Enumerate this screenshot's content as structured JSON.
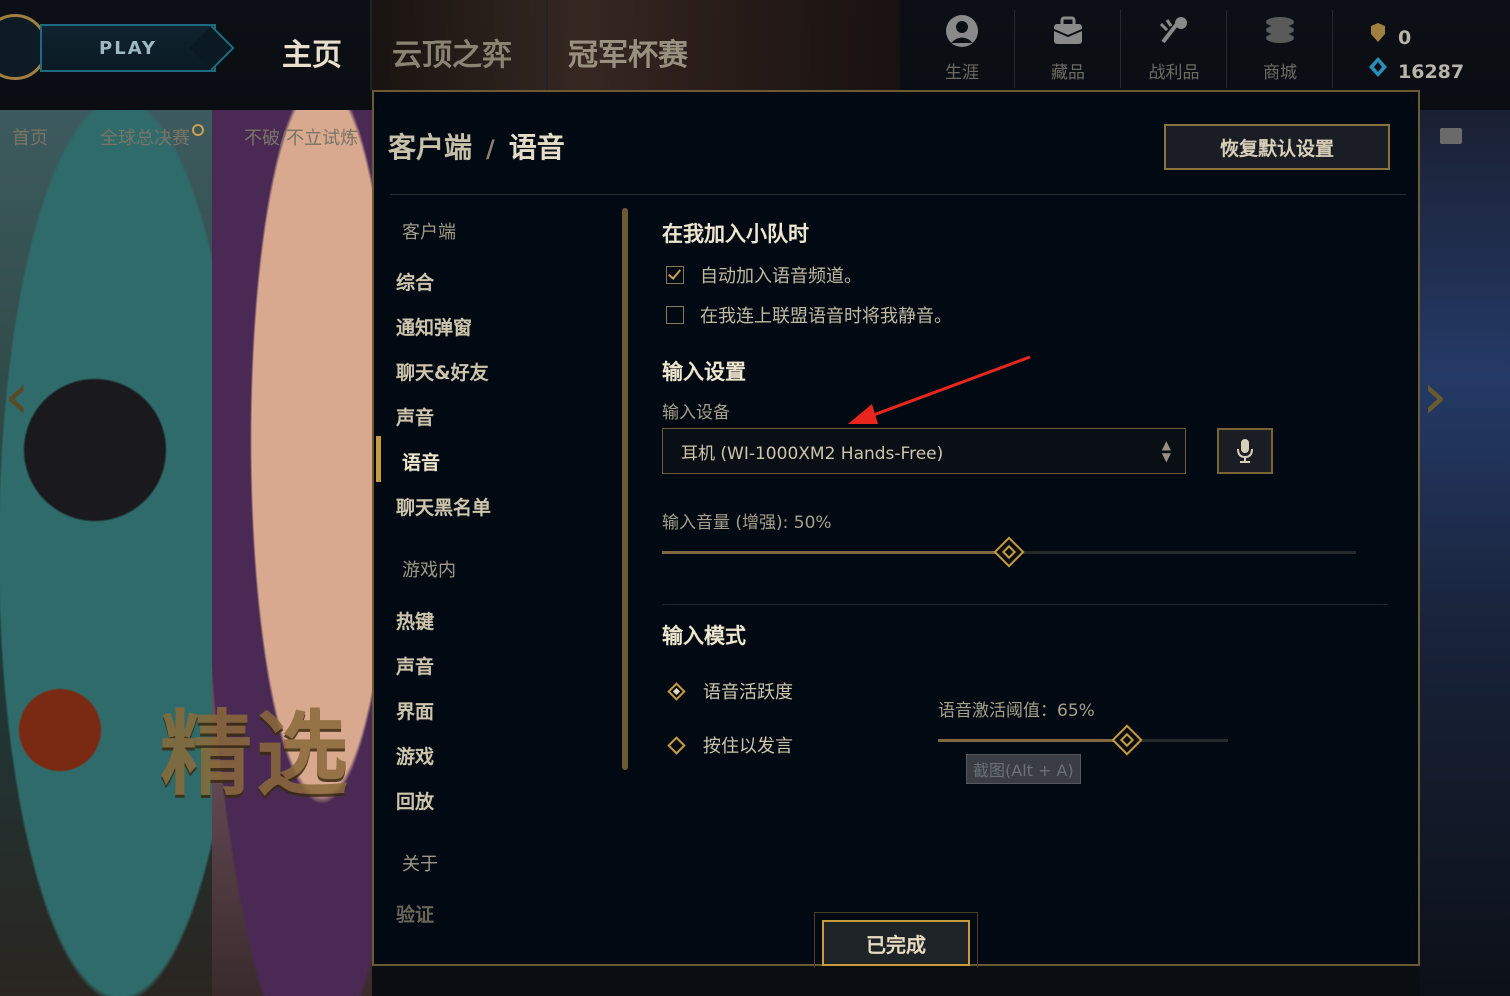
{
  "topnav": {
    "play_label": "PLAY",
    "tabs": [
      "主页",
      "云顶之弈",
      "冠军杯赛"
    ],
    "icons": [
      {
        "name": "profile-icon",
        "label": "生涯"
      },
      {
        "name": "collection-icon",
        "label": "藏品"
      },
      {
        "name": "loot-icon",
        "label": "战利品"
      },
      {
        "name": "store-icon",
        "label": "商城"
      }
    ],
    "currency": {
      "rp": "0",
      "be": "16287"
    },
    "subnav": [
      "首页",
      "全球总决赛",
      "不破/不立试炼"
    ]
  },
  "background": {
    "promo_text": "精选"
  },
  "modal": {
    "breadcrumb": {
      "parent": "客户端",
      "separator": "/",
      "current": "语音"
    },
    "reset_label": "恢复默认设置",
    "menu": {
      "client_group": "客户端",
      "client_items": [
        "综合",
        "通知弹窗",
        "聊天&好友",
        "声音",
        "语音",
        "聊天黑名单"
      ],
      "ingame_group": "游戏内",
      "ingame_items": [
        "热键",
        "声音",
        "界面",
        "游戏",
        "回放"
      ],
      "about_group": "关于",
      "about_items": [
        "验证"
      ]
    },
    "party": {
      "title": "在我加入小队时",
      "auto_join": {
        "label": "自动加入语音频道。",
        "checked": true
      },
      "mute_on_connect": {
        "label": "在我连上联盟语音时将我静音。",
        "checked": false
      }
    },
    "input_settings": {
      "title": "输入设置",
      "device_label": "输入设备",
      "device_value": "耳机 (WI-1000XM2 Hands-Free)",
      "volume_label": "输入音量 (增强): 50%",
      "volume_level": 0.5
    },
    "input_mode": {
      "title": "输入模式",
      "options": [
        "语音活跃度",
        "按住以发言"
      ],
      "selected": "语音活跃度",
      "threshold_label": "语音激活阈值：65%",
      "threshold_level": 0.65
    },
    "tooltip": "截图(Alt + A)",
    "done_label": "已完成"
  },
  "colors": {
    "gold": "#c89b3c",
    "panel": "#010a13",
    "annotation": "#e8261e"
  }
}
